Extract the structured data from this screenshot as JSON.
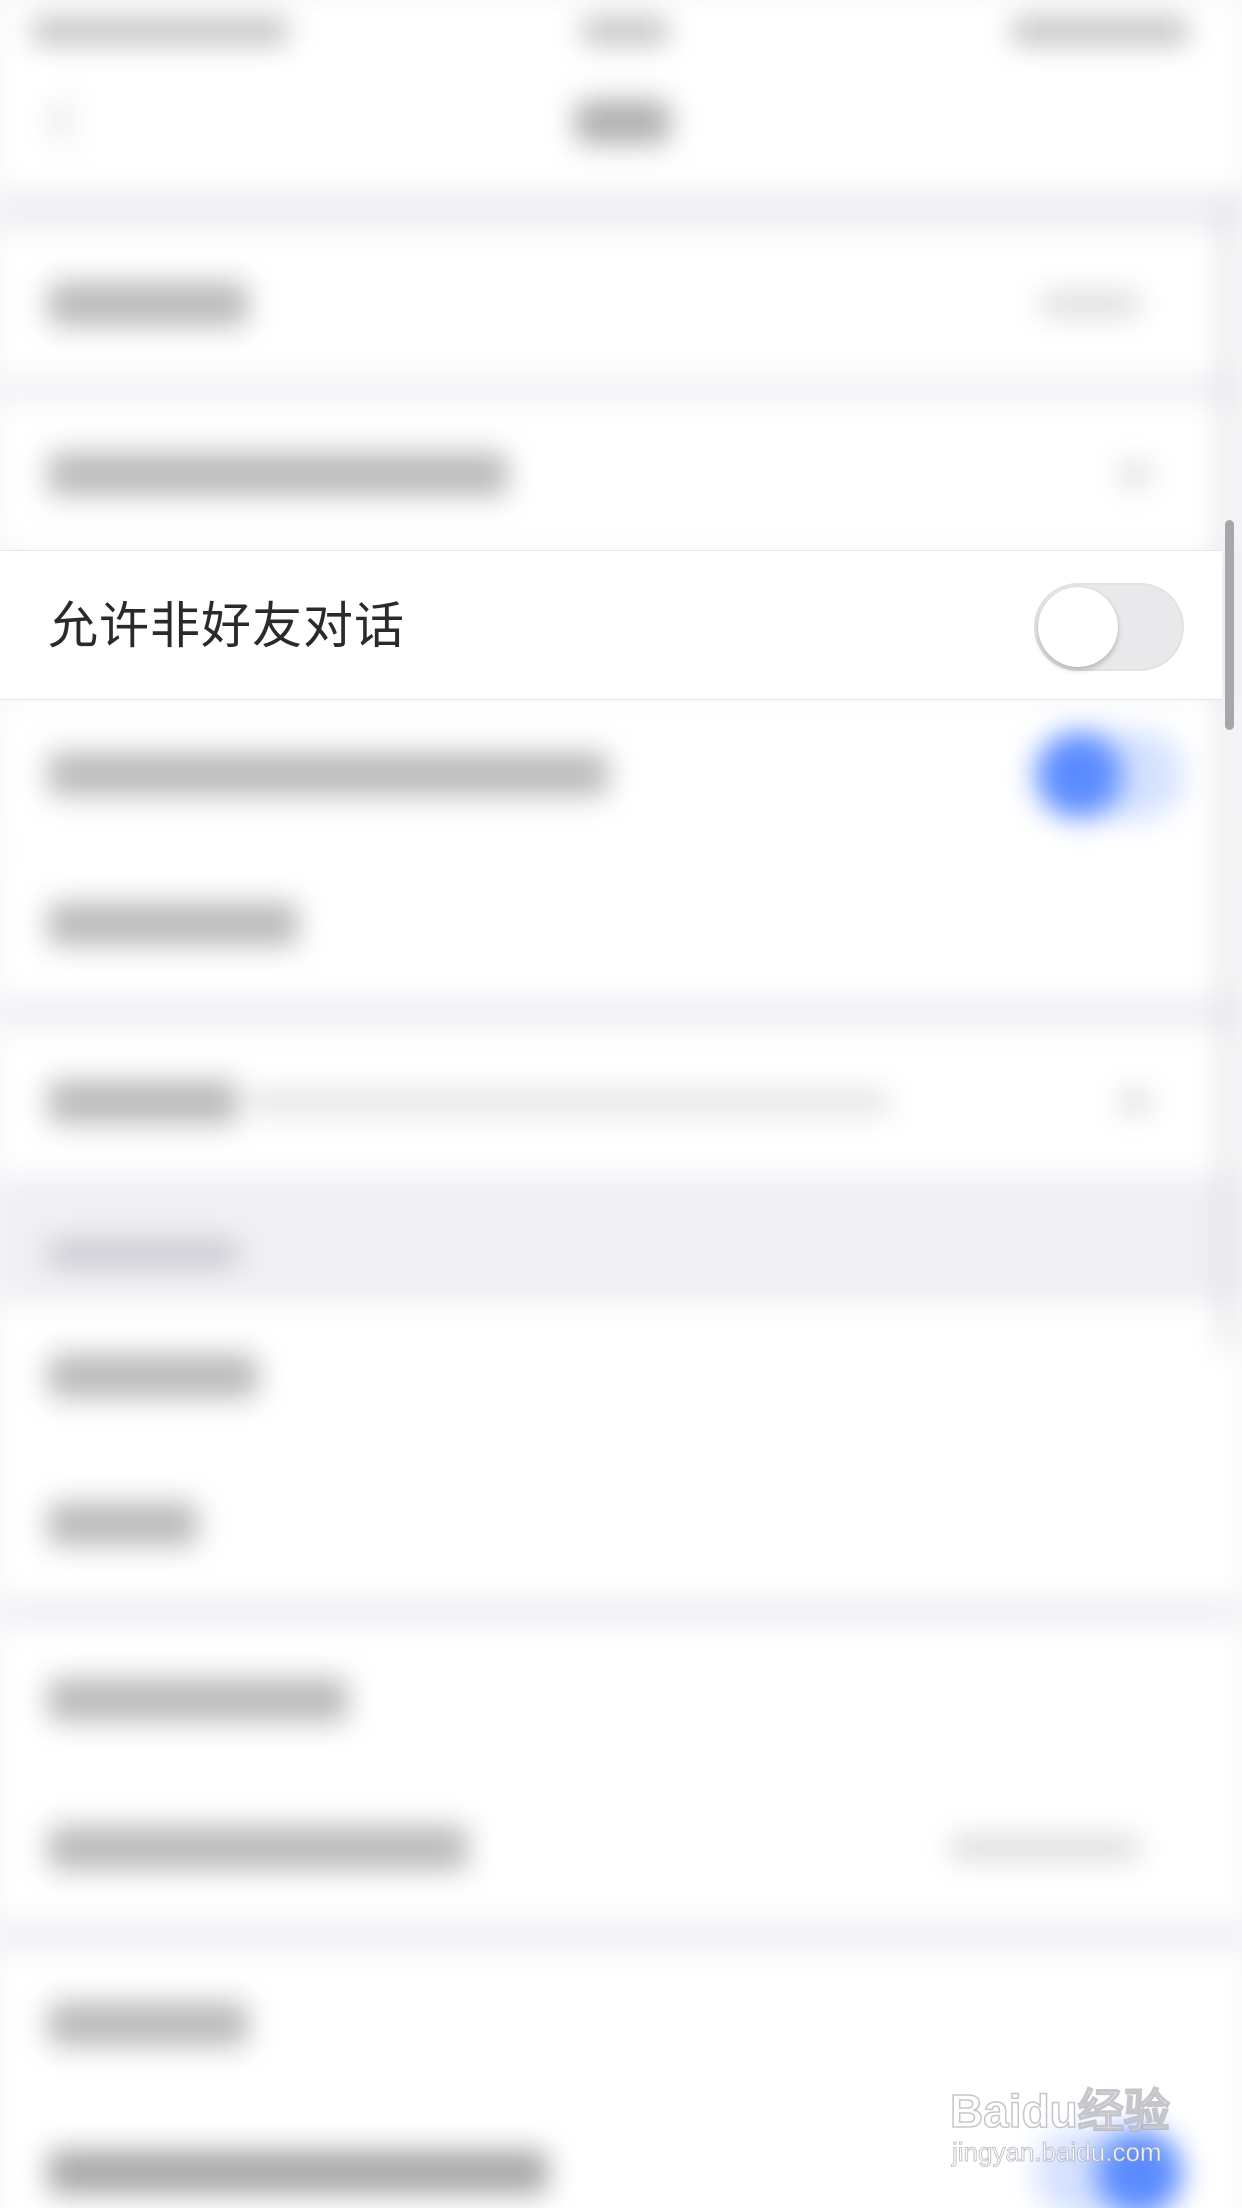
{
  "focused_setting": {
    "label": "允许非好友对话",
    "toggle_on": false
  },
  "colors": {
    "toggle_off_track": "#e9e9eb",
    "toggle_knob": "#ffffff",
    "accent_blue": "#5b8cff",
    "label_text": "#2a2a2a",
    "section_bg": "#efeff4"
  },
  "watermark": {
    "logo": "Baidu经验",
    "url": "jingyan.baidu.com"
  }
}
